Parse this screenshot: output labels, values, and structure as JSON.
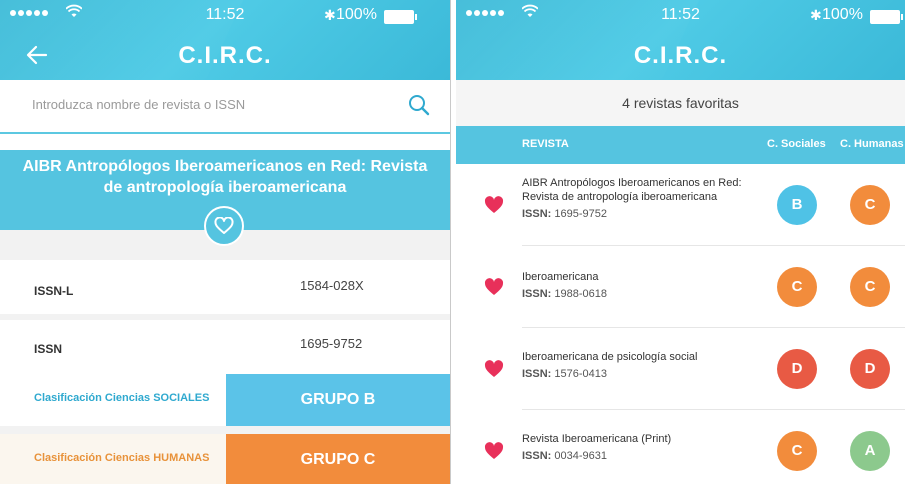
{
  "status_bar": {
    "time": "11:52",
    "battery": "100%"
  },
  "app": {
    "title": "C.I.R.C."
  },
  "detail": {
    "search_placeholder": "Introduzca nombre de revista o ISSN",
    "journal_title": "AIBR Antropólogos Iberoamericanos en Red: Revista de antropología iberoamericana",
    "rows": [
      {
        "label": "ISSN-L",
        "value": "1584-028X"
      },
      {
        "label": "ISSN",
        "value": "1695-9752"
      }
    ],
    "classifications": [
      {
        "label": "Clasificación Ciencias SOCIALES",
        "group": "GRUPO B",
        "label_color": "#2fa9cf",
        "box_color": "#5bc3e8"
      },
      {
        "label": "Clasificación Ciencias HUMANAS",
        "group": "GRUPO C",
        "label_color": "#e8923a",
        "box_color": "#f28c3c"
      }
    ]
  },
  "favorites": {
    "count_text": "4 revistas favoritas",
    "columns": {
      "journal": "REVISTA",
      "sociales": "C. Sociales",
      "humanas": "C. Humanas"
    },
    "issn_label": "ISSN:",
    "items": [
      {
        "name": "AIBR Antropólogos Iberoamericanos en Red: Revista de antropología iberoamericana",
        "issn": "1695-9752",
        "sociales": "B",
        "humanas": "C"
      },
      {
        "name": "Iberoamericana",
        "issn": "1988-0618",
        "sociales": "C",
        "humanas": "C"
      },
      {
        "name": "Iberoamericana de psicología social",
        "issn": "1576-0413",
        "sociales": "D",
        "humanas": "D"
      },
      {
        "name": "Revista Iberoamericana (Print)",
        "issn": "0034-9631",
        "sociales": "C",
        "humanas": "A"
      }
    ]
  },
  "colors": {
    "accent": "#55c4e0",
    "heart": "#e8305a",
    "grade_A": "#8cc98d",
    "grade_B": "#4fc2e6",
    "grade_C": "#f28c3c",
    "grade_D": "#e85a44"
  }
}
